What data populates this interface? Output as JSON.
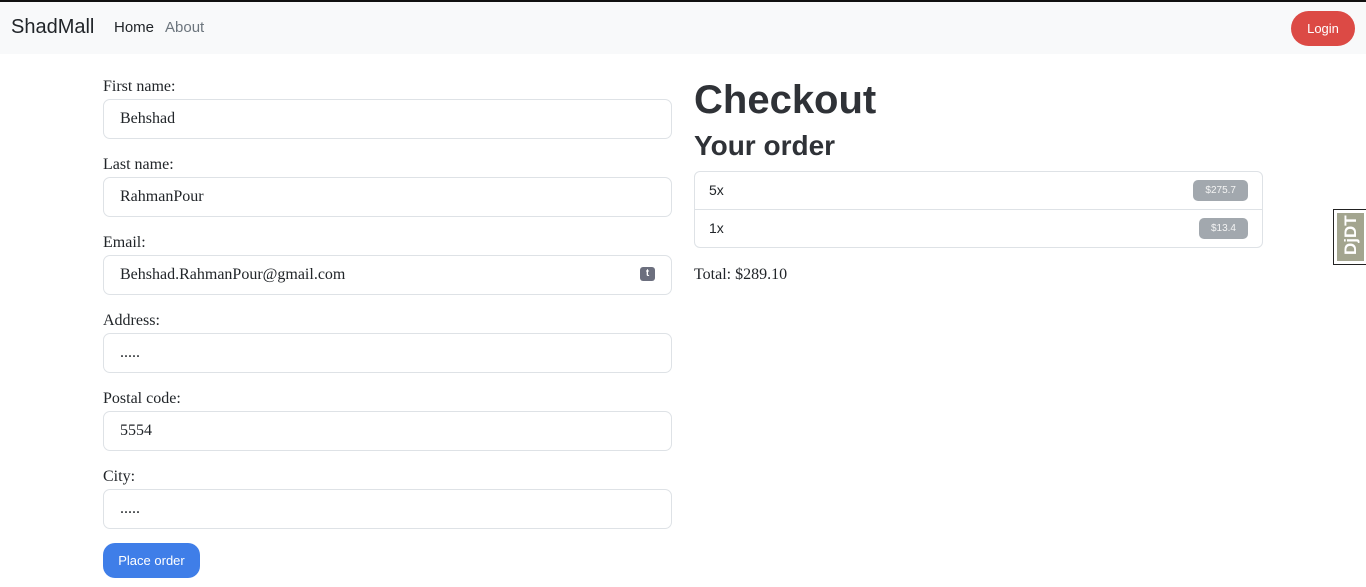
{
  "navbar": {
    "brand": "ShadMall",
    "links": [
      "Home",
      "About"
    ],
    "login_label": "Login"
  },
  "form": {
    "first_name": {
      "label": "First name:",
      "value": "Behshad"
    },
    "last_name": {
      "label": "Last name:",
      "value": "RahmanPour"
    },
    "email": {
      "label": "Email:",
      "value": "Behshad.RahmanPour@gmail.com",
      "autofill_icon": "t"
    },
    "address": {
      "label": "Address:",
      "value": "....."
    },
    "postal_code": {
      "label": "Postal code:",
      "value": "5554"
    },
    "city": {
      "label": "City:",
      "value": "....."
    },
    "submit_label": "Place order"
  },
  "checkout": {
    "title": "Checkout",
    "order_title": "Your order",
    "items": [
      {
        "quantity": "5x",
        "price": "$275.7"
      },
      {
        "quantity": "1x",
        "price": "$13.4"
      }
    ],
    "total_label": "Total:",
    "total_value": "$289.10"
  },
  "debug_toolbar": {
    "label": "DjDT"
  },
  "colors": {
    "login_button": "#dc4a45",
    "place_order_button": "#3f7ee8",
    "price_badge": "#a2a8ae",
    "navbar_bg": "#f8f9fa"
  }
}
